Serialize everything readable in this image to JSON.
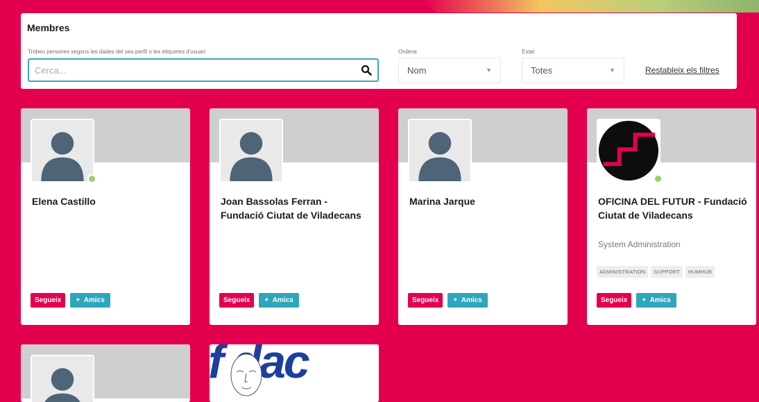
{
  "panel": {
    "title": "Membres",
    "search_label": "Trobeu persones segons les dades del seu perfil o les etiquetes d'usuari",
    "search_placeholder": "Cerca...",
    "sort_label": "Ordena",
    "sort_value": "Nom",
    "status_label": "Estat",
    "status_value": "Totes",
    "reset_label": "Restableix els filtres"
  },
  "buttons": {
    "follow": "Segueix",
    "friends": "Amics",
    "friends_icon": "+"
  },
  "members": [
    {
      "name": "Elena Castillo",
      "subtitle": "",
      "online": true,
      "tags": []
    },
    {
      "name": "Joan Bassolas Ferran - Fundació Ciutat de Viladecans",
      "subtitle": "",
      "online": false,
      "tags": []
    },
    {
      "name": "Marina Jarque",
      "subtitle": "",
      "online": false,
      "tags": []
    },
    {
      "name": "OFICINA DEL FUTUR - Fundació Ciutat de Viladecans",
      "subtitle": "System Administration",
      "online": true,
      "tags": [
        "ADMINISTRATION",
        "SUPPORT",
        "HUMHUB"
      ]
    }
  ],
  "partial_cards": {
    "logo_text": "f  dac"
  },
  "colors": {
    "background": "#e3004f",
    "accent": "#2fa6bb",
    "online": "#97d16a",
    "avatar_silhouette": "#4e6477"
  }
}
